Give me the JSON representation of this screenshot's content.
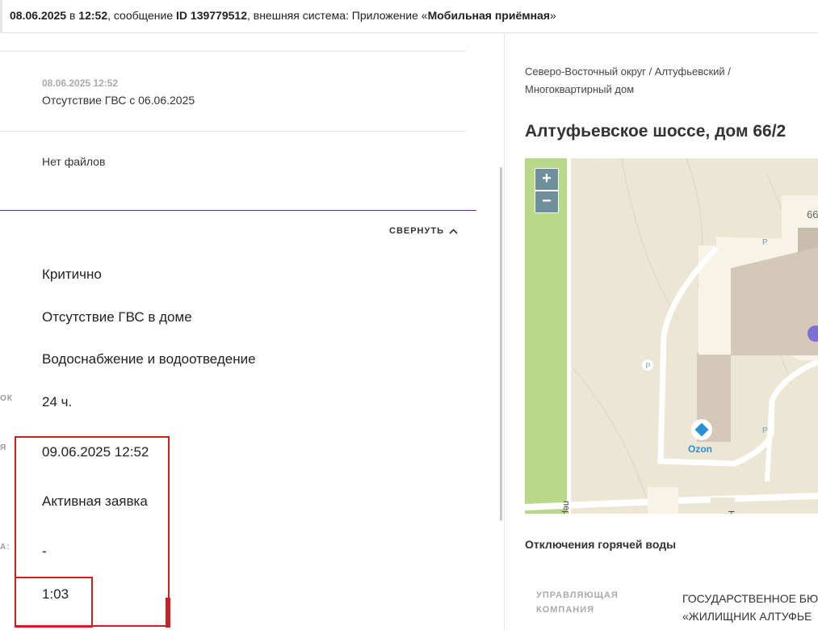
{
  "header": {
    "date": "08.06.2025",
    "in_word": "в",
    "time": "12:52",
    "message_text": ", сообщение ",
    "id_label": "ID 139779512",
    "system_text": ", внешняя система: Приложение «",
    "system_name": "Мобильная приёмная",
    "close_quote": "»"
  },
  "comment": {
    "timestamp": "08.06.2025 12:52",
    "text": "Отсутствие ГВС с 06.06.2025"
  },
  "files": {
    "text": "Нет файлов"
  },
  "collapse_label": "СВЕРНУТЬ",
  "details": {
    "label_deadline": "ОК",
    "label_due": "Я",
    "label_comment": "А:",
    "priority": "Критично",
    "problem": "Отсутствие ГВС в доме",
    "category": "Водоснабжение и водоотведение",
    "deadline": "24 ч.",
    "due_date": "09.06.2025 12:52",
    "status": "Активная заявка",
    "dash": "-",
    "timer": "1:03"
  },
  "location": {
    "breadcrumb_line1": "Северо-Восточный округ / Алтуфьевский /",
    "breadcrumb_line2": "Многоквартирный дом",
    "address": "Алтуфьевское шоссе, дом 66/2"
  },
  "map": {
    "zoom_in": "+",
    "zoom_out": "−",
    "house_number": "66",
    "poi_name": "Ozon",
    "parking_label": "P",
    "street_fragment": "пер",
    "bottom_glyph": "Н"
  },
  "outages": {
    "title": "Отключения горячей воды",
    "mgmt_label_line1": "УПРАВЛЯЮЩАЯ",
    "mgmt_label_line2": "КОМПАНИЯ",
    "mgmt_value_line1": "ГОСУДАРСТВЕННОЕ БЮ",
    "mgmt_value_line2": "«ЖИЛИЩНИК АЛТУФЬЕ"
  },
  "colors": {
    "highlight": "#cc1f1f",
    "divider_dark": "#3a3d7a",
    "map_bg": "#ece6d4",
    "map_green": "#b9d98a",
    "map_building": "#d4c9b9",
    "zoom_button": "#6f8f9d",
    "poi_blue": "#2a8fd6"
  }
}
